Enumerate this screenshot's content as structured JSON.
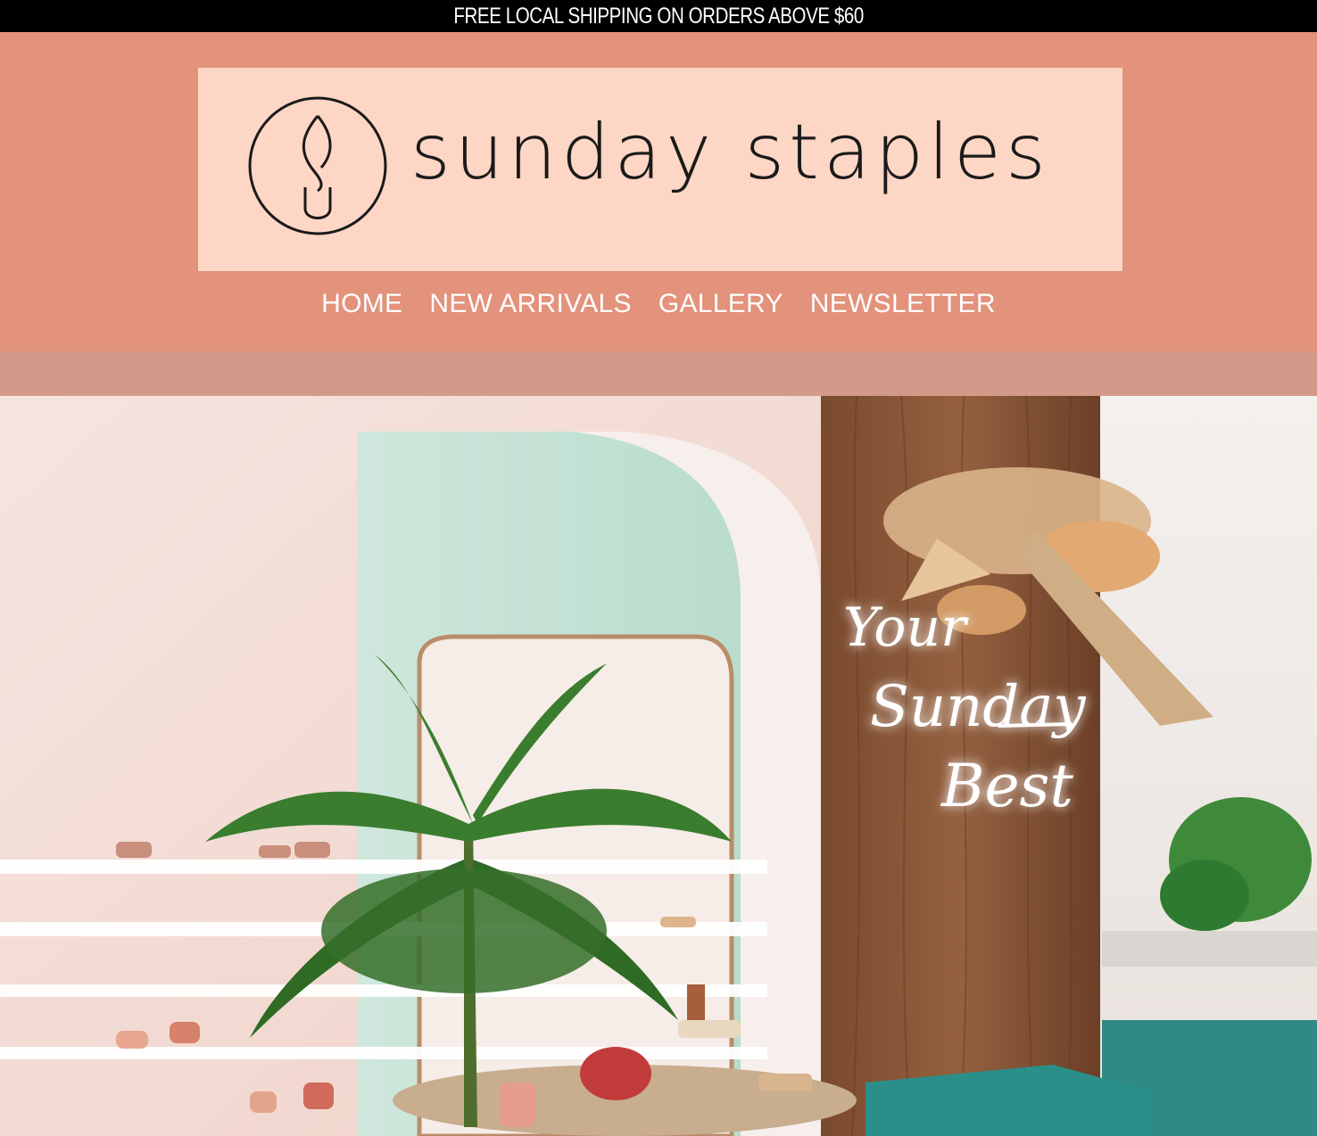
{
  "announcement": {
    "text": "FREE LOCAL SHIPPING ON ORDERS ABOVE $60"
  },
  "brand": {
    "name": "sunday staples",
    "logo_icon": "ss-monogram-icon"
  },
  "nav": {
    "items": [
      {
        "label": "HOME"
      },
      {
        "label": "NEW ARRIVALS"
      },
      {
        "label": "GALLERY"
      },
      {
        "label": "NEWSLETTER"
      }
    ]
  },
  "hero": {
    "neon_lines": [
      "Your",
      "Sunday",
      "Best"
    ],
    "kind": "store-interior-photo"
  },
  "colors": {
    "announcement_bg": "#000000",
    "header_bg": "#e3927b",
    "logo_bg": "#fed6c5",
    "band_bg": "#d49a89"
  }
}
